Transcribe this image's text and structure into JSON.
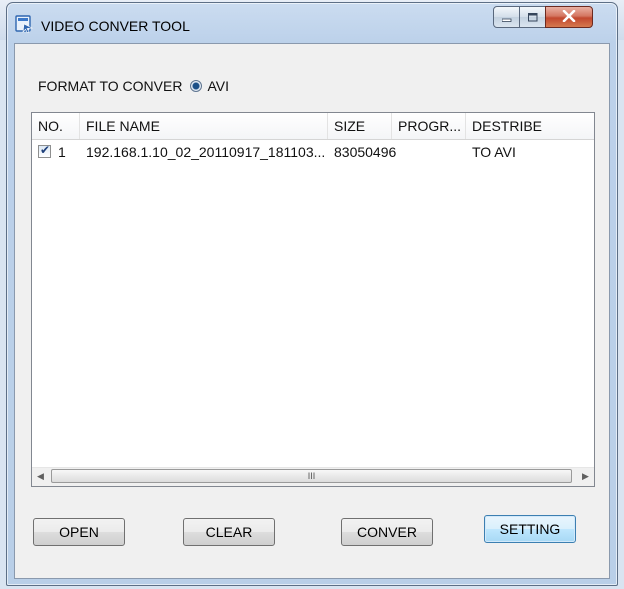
{
  "window": {
    "title": "VIDEO CONVER TOOL"
  },
  "format": {
    "label": "FORMAT TO CONVER",
    "option": "AVI",
    "selected": true
  },
  "table": {
    "columns": [
      "NO.",
      "FILE NAME",
      "SIZE",
      "PROGR...",
      "DESTRIBE"
    ],
    "rows": [
      {
        "checked": true,
        "no": "1",
        "file_name": "192.168.1.10_02_20110917_181103...",
        "size": "83050496",
        "progress": "",
        "describe": "TO AVI"
      }
    ]
  },
  "scrollbar": {
    "thumb_grip": "III"
  },
  "buttons": {
    "open": "OPEN",
    "clear": "CLEAR",
    "conver": "CONVER",
    "setting": "SETTING"
  },
  "colors": {
    "accent": "#3c7fb1",
    "window_frame": "#b9cfe8",
    "close_button": "#c2472f"
  }
}
